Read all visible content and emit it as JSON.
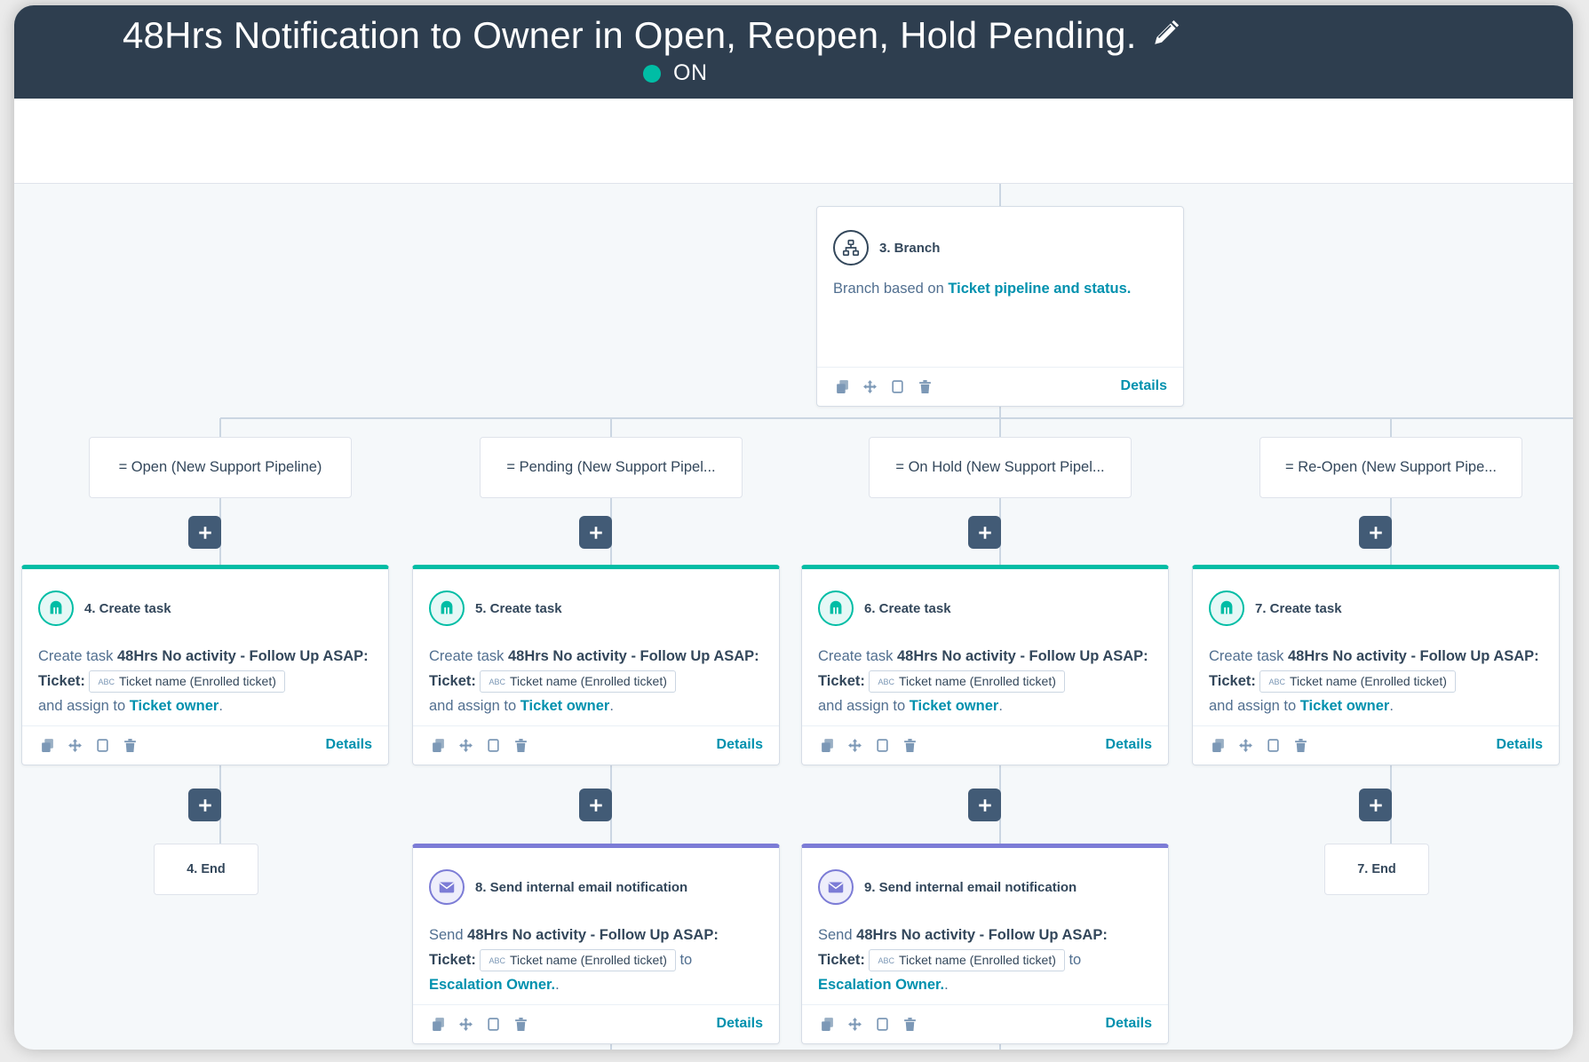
{
  "header": {
    "title": "48Hrs Notification to Owner in Open, Reopen, Hold Pending.",
    "status": "ON",
    "status_color": "#00bda5",
    "edit_icon": "pencil-icon"
  },
  "colors": {
    "header_bg": "#2e3e4f",
    "task_accent": "#00bda5",
    "email_accent": "#7c7cd6",
    "link": "#0091ae",
    "plus_button": "#425b76"
  },
  "branch": {
    "title": "3. Branch",
    "body_prefix": "Branch based on",
    "body_link": "Ticket pipeline and status.",
    "details": "Details",
    "icon": "branch-icon"
  },
  "conditions": [
    "= Open (New Support Pipeline)",
    "= Pending (New Support Pipel...",
    "= On Hold (New Support Pipel...",
    "= Re-Open (New Support Pipe..."
  ],
  "tasks": [
    {
      "title": "4. Create task",
      "prefix": "Create task",
      "bold": "48Hrs No activity - Follow Up ASAP: Ticket:",
      "chip": "Ticket name (Enrolled ticket)",
      "assign": "and assign to",
      "owner": "Ticket owner",
      "period": ".",
      "details": "Details"
    },
    {
      "title": "5. Create task",
      "prefix": "Create task",
      "bold": "48Hrs No activity - Follow Up ASAP: Ticket:",
      "chip": "Ticket name (Enrolled ticket)",
      "assign": "and assign to",
      "owner": "Ticket owner",
      "period": ".",
      "details": "Details"
    },
    {
      "title": "6. Create task",
      "prefix": "Create task",
      "bold": "48Hrs No activity - Follow Up ASAP: Ticket:",
      "chip": "Ticket name (Enrolled ticket)",
      "assign": "and assign to",
      "owner": "Ticket owner",
      "period": ".",
      "details": "Details"
    },
    {
      "title": "7. Create task",
      "prefix": "Create task",
      "bold": "48Hrs No activity - Follow Up ASAP: Ticket:",
      "chip": "Ticket name (Enrolled ticket)",
      "assign": "and assign to",
      "owner": "Ticket owner",
      "period": ".",
      "details": "Details"
    }
  ],
  "emails": [
    {
      "title": "8. Send internal email notification",
      "prefix": "Send",
      "bold": "48Hrs No activity - Follow Up ASAP:",
      "bold2": "Ticket:",
      "chip": "Ticket name (Enrolled ticket)",
      "to": "to",
      "recipient": "Escalation Owner.",
      "period": ".",
      "details": "Details"
    },
    {
      "title": "9. Send internal email notification",
      "prefix": "Send",
      "bold": "48Hrs No activity - Follow Up ASAP:",
      "bold2": "Ticket:",
      "chip": "Ticket name (Enrolled ticket)",
      "to": "to",
      "recipient": "Escalation Owner.",
      "period": ".",
      "details": "Details"
    }
  ],
  "ends": [
    "4. End",
    "7. End"
  ],
  "chip_prefix": "ABC",
  "action_icons": [
    "clone-icon",
    "move-icon",
    "copy-icon",
    "delete-icon"
  ]
}
